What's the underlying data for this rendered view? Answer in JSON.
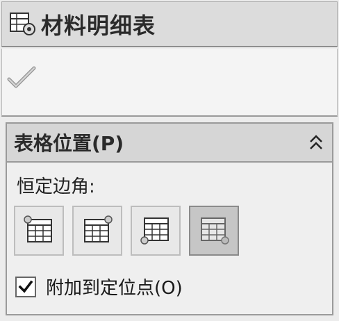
{
  "panel": {
    "title": "材料明细表",
    "title_icon": "bom-table-icon",
    "ok_icon": "checkmark-icon"
  },
  "group": {
    "title": "表格位置(P)",
    "collapse_icon": "double-chevron-up-icon",
    "anchor_label": "恒定边角:",
    "anchor_buttons": [
      {
        "name": "anchor-top-left",
        "icon": "table-anchor-top-left-icon",
        "active": false
      },
      {
        "name": "anchor-top-right",
        "icon": "table-anchor-top-right-icon",
        "active": false
      },
      {
        "name": "anchor-bottom-left",
        "icon": "table-anchor-bottom-left-icon",
        "active": false
      },
      {
        "name": "anchor-bottom-right",
        "icon": "table-anchor-bottom-right-icon",
        "active": true
      }
    ],
    "attach_label": "附加到定位点(O)",
    "attach_checked": true
  },
  "colors": {
    "background": "#ececec",
    "header": "#d6d6d6",
    "border": "#9a9a9a",
    "active_button": "#c6c6c6"
  }
}
